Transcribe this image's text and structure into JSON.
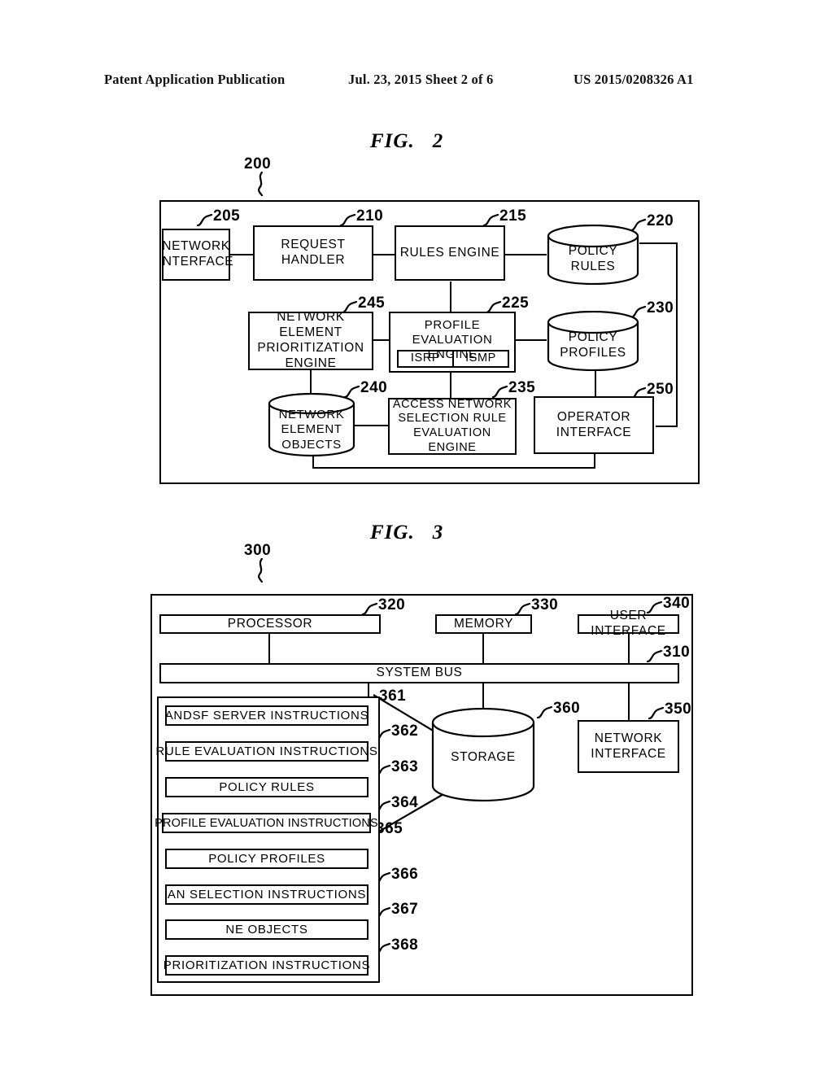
{
  "header": {
    "publication": "Patent Application Publication",
    "date_sheet": "Jul. 23, 2015   Sheet 2 of 6",
    "pub_number": "US 2015/0208326 A1"
  },
  "figures": [
    {
      "caption_prefix": "FIG.",
      "caption_number": "2",
      "system_ref": "200",
      "nodes": [
        {
          "ref": "205",
          "label": "NETWORK\nINTERFACE",
          "shape": "box"
        },
        {
          "ref": "210",
          "label": "REQUEST\nHANDLER",
          "shape": "box"
        },
        {
          "ref": "215",
          "label": "RULES  ENGINE",
          "shape": "box"
        },
        {
          "ref": "220",
          "label": "POLICY\nRULES",
          "shape": "cylinder"
        },
        {
          "ref": "245",
          "label": "NETWORK  ELEMENT\nPRIORITIZATION\nENGINE",
          "shape": "box"
        },
        {
          "ref": "225",
          "label": "PROFILE  EVALUATION\nENGINE",
          "shape": "box",
          "sub": [
            "ISRP",
            "ISMP"
          ]
        },
        {
          "ref": "230",
          "label": "POLICY\nPROFILES",
          "shape": "cylinder"
        },
        {
          "ref": "240",
          "label": "NETWORK\nELEMENT\nOBJECTS",
          "shape": "cylinder"
        },
        {
          "ref": "235",
          "label": "ACCESS  NETWORK\nSELECTION  RULE\nEVALUATION  ENGINE",
          "shape": "box"
        },
        {
          "ref": "250",
          "label": "OPERATOR\nINTERFACE",
          "shape": "box"
        }
      ]
    },
    {
      "caption_prefix": "FIG.",
      "caption_number": "3",
      "system_ref": "300",
      "nodes": [
        {
          "ref": "320",
          "label": "PROCESSOR",
          "shape": "box"
        },
        {
          "ref": "330",
          "label": "MEMORY",
          "shape": "box"
        },
        {
          "ref": "340",
          "label": "USER  INTERFACE",
          "shape": "box"
        },
        {
          "ref": "310",
          "label": "SYSTEM  BUS",
          "shape": "box"
        },
        {
          "ref": "360",
          "label": "STORAGE",
          "shape": "cylinder"
        },
        {
          "ref": "350",
          "label": "NETWORK\nINTERFACE",
          "shape": "box"
        }
      ],
      "memory_items": [
        {
          "ref": "361",
          "label": "ANDSF  SERVER  INSTRUCTIONS"
        },
        {
          "ref": "362",
          "label": "RULE  EVALUATION  INSTRUCTIONS"
        },
        {
          "ref": "363",
          "label": "POLICY  RULES"
        },
        {
          "ref": "364",
          "label": "PROFILE  EVALUATION  INSTRUCTIONS"
        },
        {
          "ref": "365",
          "label": "POLICY  PROFILES"
        },
        {
          "ref": "366",
          "label": "AN  SELECTION  INSTRUCTIONS"
        },
        {
          "ref": "367",
          "label": "NE  OBJECTS"
        },
        {
          "ref": "368",
          "label": "PRIORITIZATION  INSTRUCTIONS"
        }
      ]
    }
  ],
  "colors": {
    "ink": "#000000",
    "paper": "#ffffff"
  }
}
